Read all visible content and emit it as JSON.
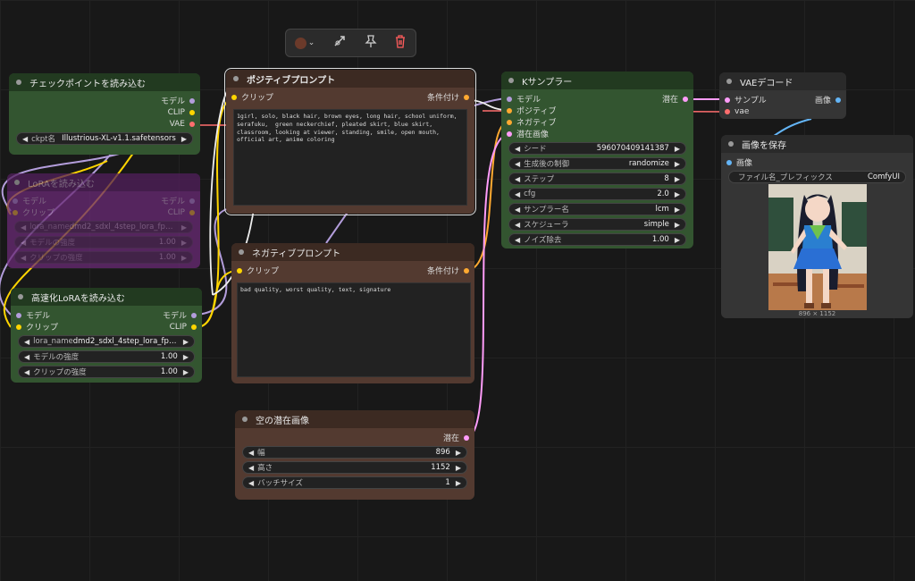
{
  "toolbar": {
    "color_icon": "color-circle-icon",
    "chevron": "⌄",
    "bypass_icon": "bypass-icon",
    "pin_icon": "pin-icon",
    "delete_icon": "trash-icon"
  },
  "ckpt": {
    "title": "チェックポイントを読み込む",
    "out_model": "モデル",
    "out_clip": "CLIP",
    "out_vae": "VAE",
    "widget_label": "ckpt名",
    "widget_value": "Illustrious-XL-v1.1.safetensors"
  },
  "lora_bypassed": {
    "title": "LoRAを読み込む",
    "in_model": "モデル",
    "in_clip": "クリップ",
    "out_model": "モデル",
    "out_clip": "CLIP",
    "w1_label": "lora_name",
    "w1_value": "dmd2_sdxl_4step_lora_fp16...",
    "w2_label": "モデルの強度",
    "w2_value": "1.00",
    "w3_label": "クリップの強度",
    "w3_value": "1.00"
  },
  "lora_fast": {
    "title": "高速化LoRAを読み込む",
    "in_model": "モデル",
    "in_clip": "クリップ",
    "out_model": "モデル",
    "out_clip": "CLIP",
    "w1_label": "lora_name",
    "w1_value": "dmd2_sdxl_4step_lora_fp16...",
    "w2_label": "モデルの強度",
    "w2_value": "1.00",
    "w3_label": "クリップの強度",
    "w3_value": "1.00"
  },
  "positive": {
    "title": "ポジティブプロンプト",
    "in_clip": "クリップ",
    "out_cond": "条件付け",
    "text": "1girl, solo, black hair, brown eyes, long hair, school uniform, serafuku,  green neckerchief, pleated skirt, blue skirt, classroom, looking at viewer, standing, smile, open mouth, official art, anime coloring"
  },
  "negative": {
    "title": "ネガティブプロンプト",
    "in_clip": "クリップ",
    "out_cond": "条件付け",
    "text": "bad quality, worst quality, text, signature"
  },
  "latent": {
    "title": "空の潜在画像",
    "out_latent": "潜在",
    "w1_label": "幅",
    "w1_value": "896",
    "w2_label": "高さ",
    "w2_value": "1152",
    "w3_label": "バッチサイズ",
    "w3_value": "1"
  },
  "ksampler": {
    "title": "Kサンプラー",
    "in_model": "モデル",
    "in_pos": "ポジティブ",
    "in_neg": "ネガティブ",
    "in_latent": "潜在画像",
    "out_latent": "潜在",
    "widgets": [
      {
        "label": "シード",
        "value": "596070409141387"
      },
      {
        "label": "生成後の制御",
        "value": "randomize"
      },
      {
        "label": "ステップ",
        "value": "8"
      },
      {
        "label": "cfg",
        "value": "2.0"
      },
      {
        "label": "サンプラー名",
        "value": "lcm"
      },
      {
        "label": "スケジューラ",
        "value": "simple"
      },
      {
        "label": "ノイズ除去",
        "value": "1.00"
      }
    ]
  },
  "vae": {
    "title": "VAEデコード",
    "in_samples": "サンプル",
    "in_vae": "vae",
    "out_image": "画像"
  },
  "save": {
    "title": "画像を保存",
    "in_image": "画像",
    "w1_label": "ファイル名_プレフィックス",
    "w1_value": "ComfyUI",
    "image_size": "896 × 1152"
  },
  "colors": {
    "model": "#b39ddb",
    "clip": "#ffd500",
    "vae": "#ff6e6e",
    "cond": "#ffa931",
    "latent": "#ff9cf9",
    "image": "#64b5f6"
  }
}
